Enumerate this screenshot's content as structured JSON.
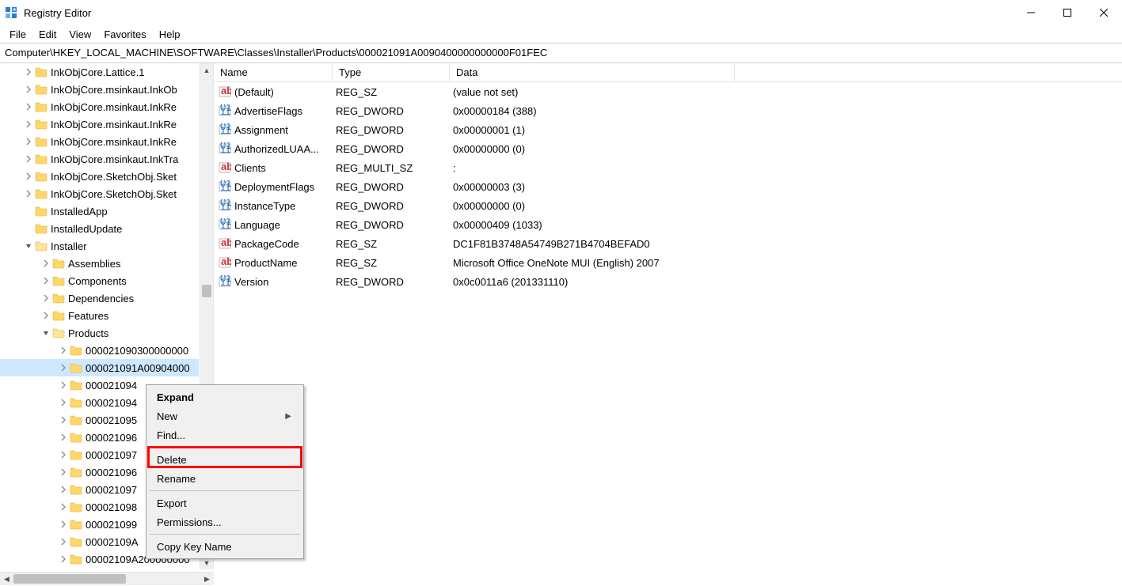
{
  "title": "Registry Editor",
  "window_buttons": {
    "min": "minimize",
    "max": "maximize",
    "close": "close"
  },
  "menubar": [
    "File",
    "Edit",
    "View",
    "Favorites",
    "Help"
  ],
  "address": "Computer\\HKEY_LOCAL_MACHINE\\SOFTWARE\\Classes\\Installer\\Products\\000021091A0090400000000000F01FEC",
  "tree": [
    {
      "indent": 1,
      "chev": ">",
      "label": "InkObjCore.Lattice.1"
    },
    {
      "indent": 1,
      "chev": ">",
      "label": "InkObjCore.msinkaut.InkOb"
    },
    {
      "indent": 1,
      "chev": ">",
      "label": "InkObjCore.msinkaut.InkRe"
    },
    {
      "indent": 1,
      "chev": ">",
      "label": "InkObjCore.msinkaut.InkRe"
    },
    {
      "indent": 1,
      "chev": ">",
      "label": "InkObjCore.msinkaut.InkRe"
    },
    {
      "indent": 1,
      "chev": ">",
      "label": "InkObjCore.msinkaut.InkTra"
    },
    {
      "indent": 1,
      "chev": ">",
      "label": "InkObjCore.SketchObj.Sket"
    },
    {
      "indent": 1,
      "chev": ">",
      "label": "InkObjCore.SketchObj.Sket"
    },
    {
      "indent": 1,
      "chev": "",
      "label": "InstalledApp"
    },
    {
      "indent": 1,
      "chev": "",
      "label": "InstalledUpdate"
    },
    {
      "indent": 1,
      "chev": "v",
      "label": "Installer",
      "open": true
    },
    {
      "indent": 2,
      "chev": ">",
      "label": "Assemblies"
    },
    {
      "indent": 2,
      "chev": ">",
      "label": "Components"
    },
    {
      "indent": 2,
      "chev": ">",
      "label": "Dependencies"
    },
    {
      "indent": 2,
      "chev": ">",
      "label": "Features"
    },
    {
      "indent": 2,
      "chev": "v",
      "label": "Products",
      "open": true
    },
    {
      "indent": 3,
      "chev": ">",
      "label": "000021090300000000"
    },
    {
      "indent": 3,
      "chev": ">",
      "label": "000021091A00904000",
      "selected": true
    },
    {
      "indent": 3,
      "chev": ">",
      "label": "000021094"
    },
    {
      "indent": 3,
      "chev": ">",
      "label": "000021094"
    },
    {
      "indent": 3,
      "chev": ">",
      "label": "000021095"
    },
    {
      "indent": 3,
      "chev": ">",
      "label": "000021096"
    },
    {
      "indent": 3,
      "chev": ">",
      "label": "000021097"
    },
    {
      "indent": 3,
      "chev": ">",
      "label": "000021096"
    },
    {
      "indent": 3,
      "chev": ">",
      "label": "000021097"
    },
    {
      "indent": 3,
      "chev": ">",
      "label": "000021098"
    },
    {
      "indent": 3,
      "chev": ">",
      "label": "000021099"
    },
    {
      "indent": 3,
      "chev": ">",
      "label": "00002109A"
    },
    {
      "indent": 3,
      "chev": ">",
      "label": "00002109A200000000"
    }
  ],
  "columns": {
    "name": "Name",
    "type": "Type",
    "data": "Data"
  },
  "values": [
    {
      "icon": "ab",
      "name": "(Default)",
      "type": "REG_SZ",
      "data": "(value not set)"
    },
    {
      "icon": "bin",
      "name": "AdvertiseFlags",
      "type": "REG_DWORD",
      "data": "0x00000184 (388)"
    },
    {
      "icon": "bin",
      "name": "Assignment",
      "type": "REG_DWORD",
      "data": "0x00000001 (1)"
    },
    {
      "icon": "bin",
      "name": "AuthorizedLUAA...",
      "type": "REG_DWORD",
      "data": "0x00000000 (0)"
    },
    {
      "icon": "ab",
      "name": "Clients",
      "type": "REG_MULTI_SZ",
      "data": ":"
    },
    {
      "icon": "bin",
      "name": "DeploymentFlags",
      "type": "REG_DWORD",
      "data": "0x00000003 (3)"
    },
    {
      "icon": "bin",
      "name": "InstanceType",
      "type": "REG_DWORD",
      "data": "0x00000000 (0)"
    },
    {
      "icon": "bin",
      "name": "Language",
      "type": "REG_DWORD",
      "data": "0x00000409 (1033)"
    },
    {
      "icon": "ab",
      "name": "PackageCode",
      "type": "REG_SZ",
      "data": "DC1F81B3748A54749B271B4704BEFAD0"
    },
    {
      "icon": "ab",
      "name": "ProductName",
      "type": "REG_SZ",
      "data": "Microsoft Office OneNote MUI (English) 2007"
    },
    {
      "icon": "bin",
      "name": "Version",
      "type": "REG_DWORD",
      "data": "0x0c0011a6 (201331110)"
    }
  ],
  "context_menu": [
    {
      "label": "Expand",
      "bold": true
    },
    {
      "label": "New",
      "submenu": true
    },
    {
      "label": "Find..."
    },
    {
      "sep": true
    },
    {
      "label": "Delete",
      "highlight": true
    },
    {
      "label": "Rename"
    },
    {
      "sep": true
    },
    {
      "label": "Export"
    },
    {
      "label": "Permissions..."
    },
    {
      "sep": true
    },
    {
      "label": "Copy Key Name"
    }
  ]
}
